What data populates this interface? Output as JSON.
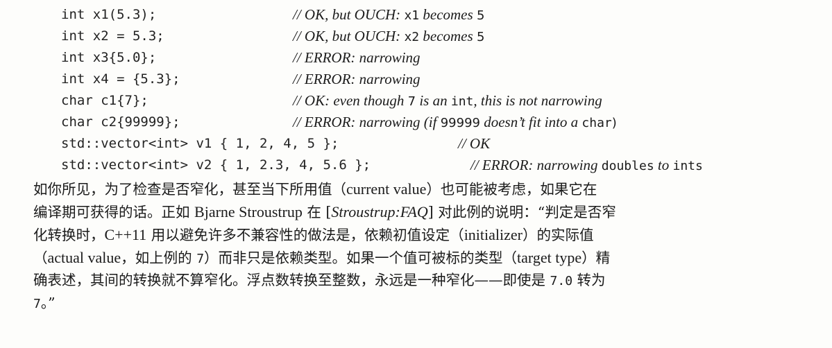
{
  "code_lines": [
    {
      "code": "int x1(5.3);",
      "comment": [
        "// OK, but OUCH: ",
        "x1",
        " becomes ",
        "5"
      ]
    },
    {
      "code": "int x2 = 5.3;",
      "comment": [
        "// OK, but OUCH: ",
        "x2",
        " becomes ",
        "5"
      ]
    },
    {
      "code": "int x3{5.0};",
      "comment": [
        "// ERROR: narrowing"
      ]
    },
    {
      "code": "int x4 = {5.3};",
      "comment": [
        "// ERROR: narrowing"
      ]
    },
    {
      "code": "char c1{7};",
      "comment": [
        "// OK: even though ",
        "7",
        " is an ",
        "int",
        ", this is not narrowing"
      ]
    },
    {
      "code": "char c2{99999};",
      "comment": [
        "// ERROR: narrowing (if ",
        "99999",
        " doesn’t fit into a ",
        "char",
        ")"
      ]
    },
    {
      "code": "std::vector<int> v1 { 1, 2, 4, 5 };",
      "comment": [
        "// OK"
      ]
    },
    {
      "code": "std::vector<int> v2 { 1, 2.3, 4, 5.6 };",
      "comment": [
        "// ERROR: narrowing ",
        "doubles",
        " to ",
        "ints"
      ]
    }
  ],
  "prose": {
    "line1": [
      "如你所见，为了检查是否窄化，甚至当下所用值（",
      "current value",
      "）也可能被考虑，如果它在"
    ],
    "line2": [
      "编译期可获得的话。正如 ",
      "Bjarne Stroustrup",
      " 在 [",
      "Stroustrup:FAQ",
      "] 对此例的说明：“判定是否窄"
    ],
    "line3": [
      "化转换时，",
      "C++11",
      " 用以避免许多不兼容性的做法是，依赖初值设定（",
      "initializer",
      "）的实际值"
    ],
    "line4": [
      "（",
      "actual value",
      "，如上例的 ",
      "7",
      "）而非只是依赖类型。如果一个值可被标的类型（",
      "target type",
      "）精"
    ],
    "line5": [
      "确表述，其间的转换就不算窄化。浮点数转换至整数，永远是一种窄化——即使是 ",
      "7.0",
      " 转为"
    ],
    "line6": [
      "7",
      "。”"
    ]
  }
}
